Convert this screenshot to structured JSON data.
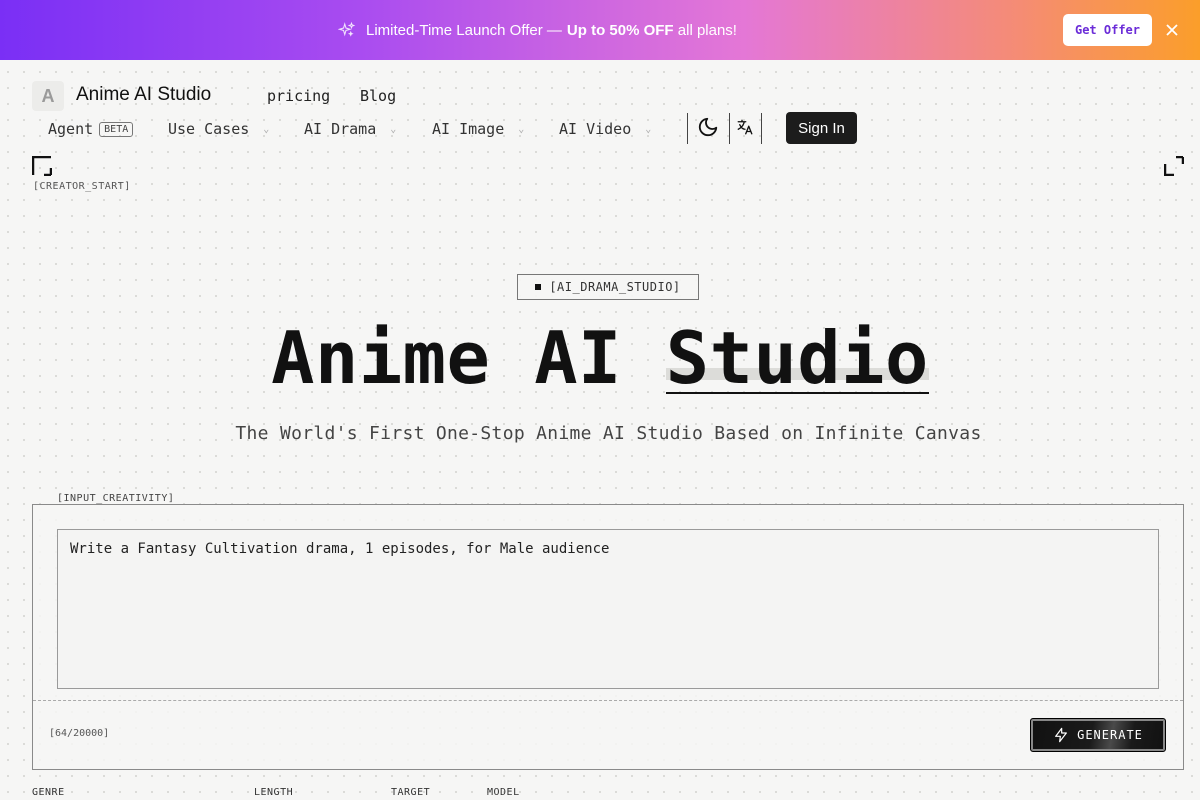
{
  "banner": {
    "prefix": "Limited-Time Launch Offer —",
    "highlight": "Up to 50% OFF",
    "suffix": "all plans!",
    "offer_button": "Get Offer",
    "close_icon": "close-icon"
  },
  "header": {
    "logo_letter": "A",
    "brand": "Anime AI Studio",
    "links": [
      "pricing",
      "Blog"
    ],
    "nav": [
      {
        "label": "Agent",
        "badge": "BETA"
      },
      {
        "label": "Use Cases"
      },
      {
        "label": "AI Drama"
      },
      {
        "label": "AI Image"
      },
      {
        "label": "AI Video"
      }
    ],
    "theme_icon": "moon-icon",
    "language_icon": "translate-icon",
    "sign_in": "Sign In"
  },
  "corner_label": "[CREATOR_START]",
  "hero": {
    "tag": "[AI_DRAMA_STUDIO]",
    "title_part1": "Anime AI",
    "title_highlight": "Studio",
    "subtitle": "The World's First One-Stop Anime AI Studio Based on Infinite Canvas"
  },
  "input": {
    "label": "[INPUT_CREATIVITY]",
    "prompt": "Write a Fantasy Cultivation drama, 1 episodes, for Male audience",
    "counter": "[64/20000]",
    "generate": "GENERATE"
  },
  "options": [
    "GENRE",
    "LENGTH",
    "TARGET",
    "MODEL"
  ],
  "colors": {
    "banner_start": "#7a2ff5",
    "banner_end": "#fb9e2a",
    "primary_dark": "#1c1c1c",
    "accent_purple": "#6b2cd8"
  }
}
